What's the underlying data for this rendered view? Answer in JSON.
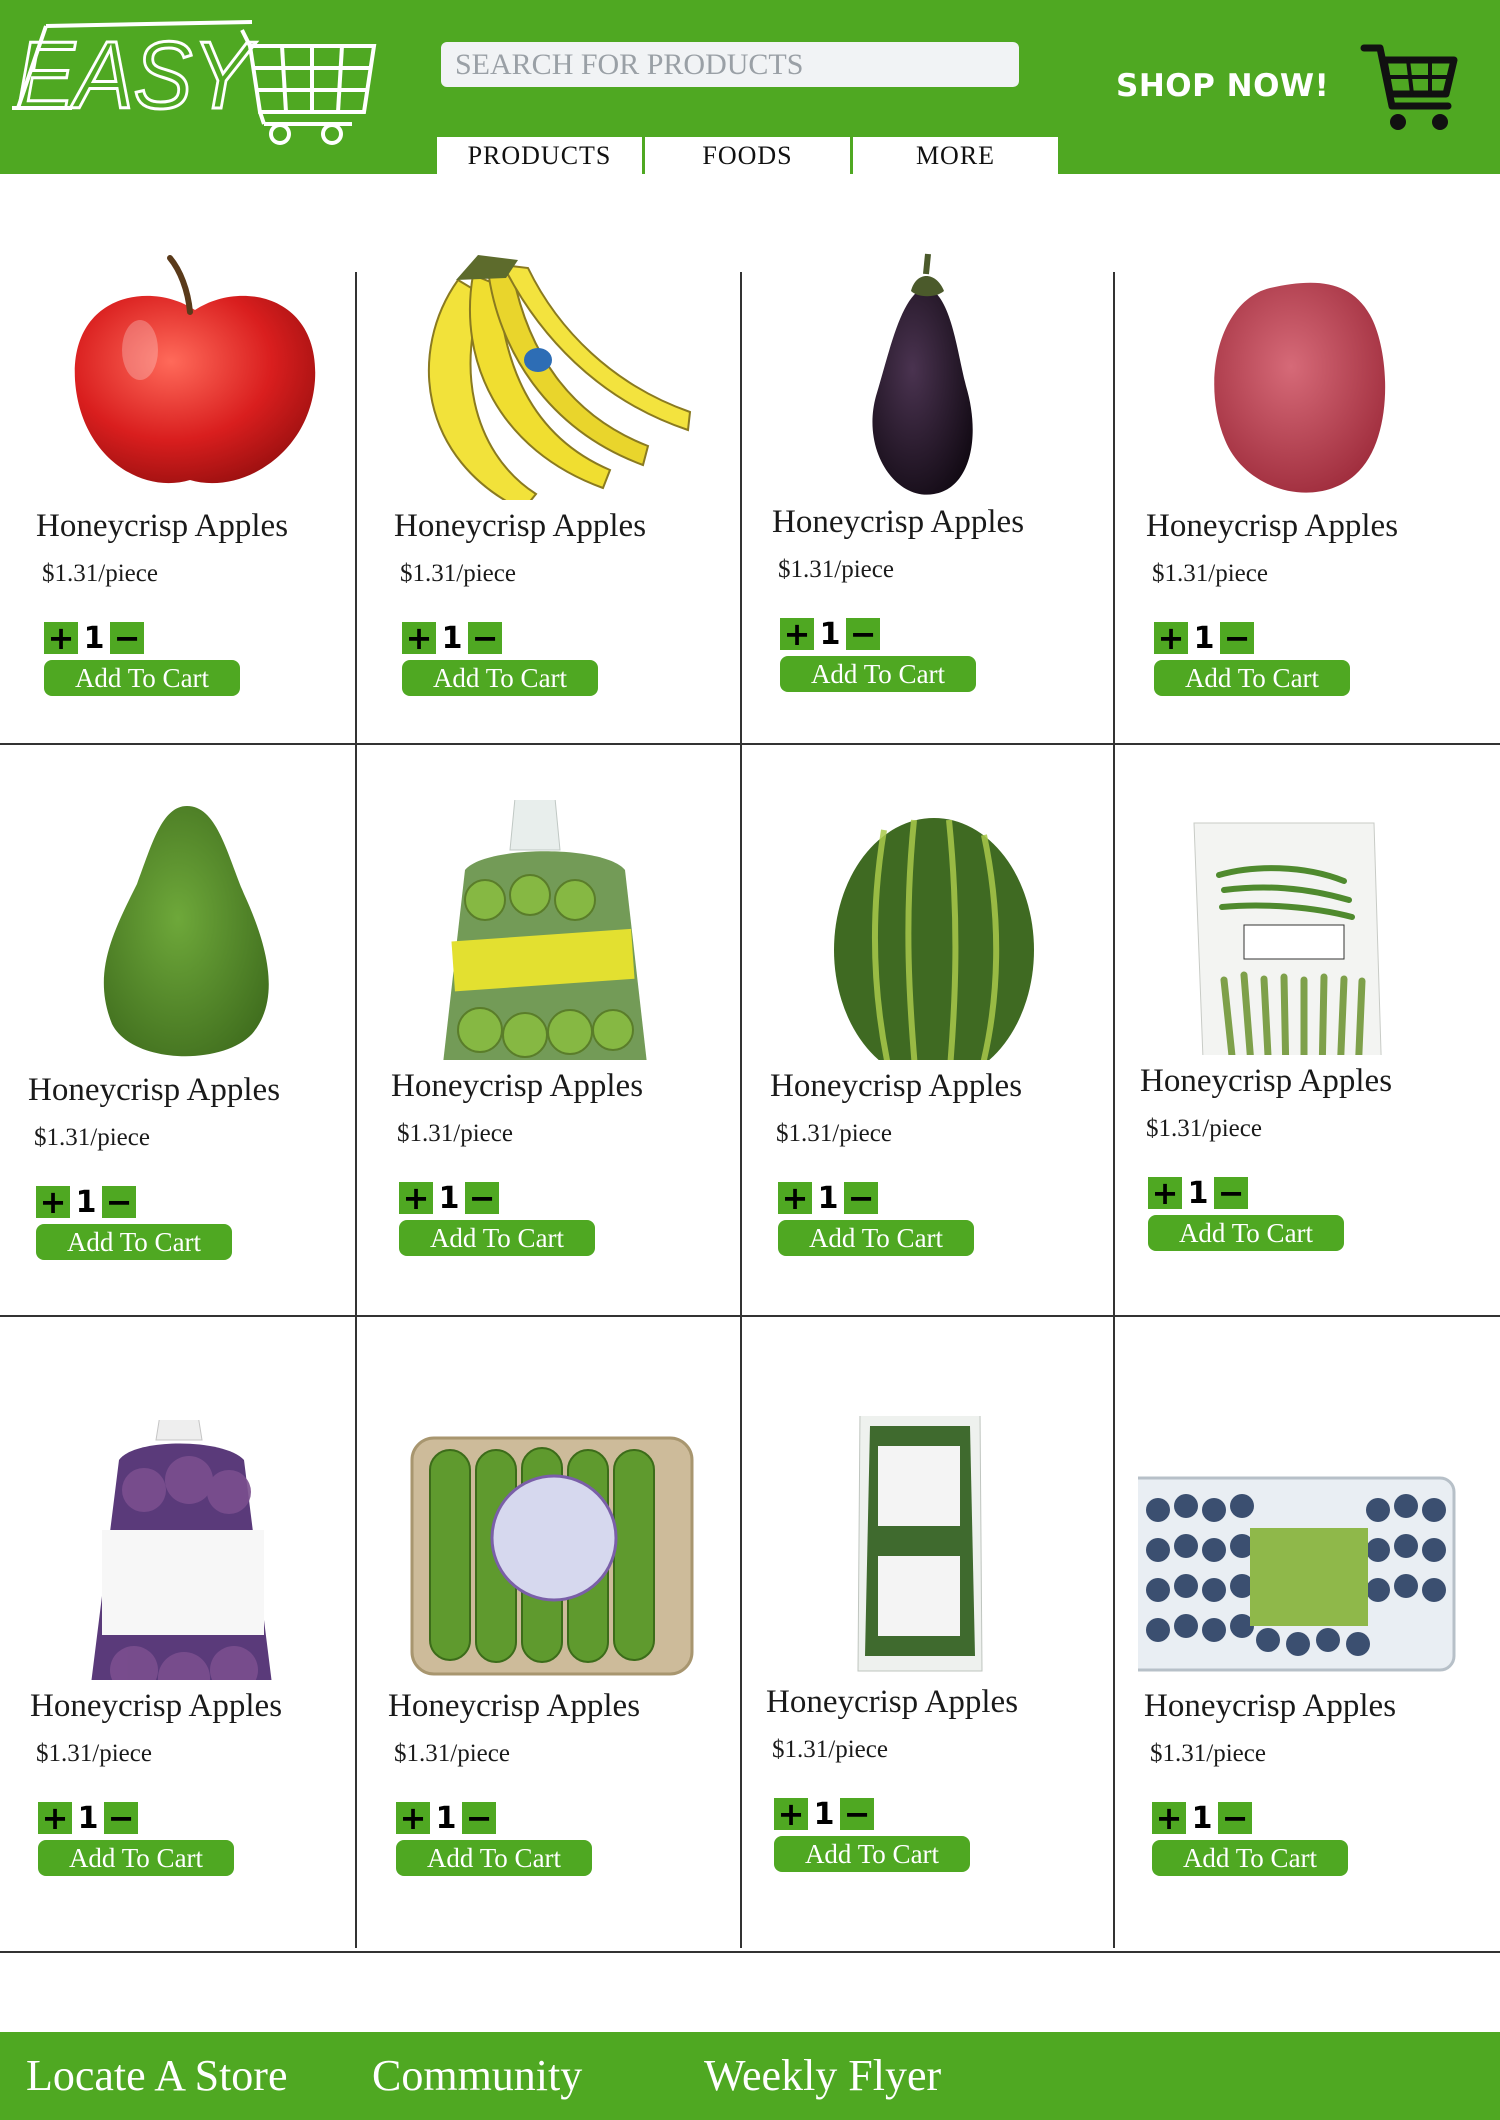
{
  "header": {
    "logo_text": "EASY",
    "search_placeholder": "SEARCH FOR PRODUCTS",
    "shop_now_label": "SHOP NOW!",
    "cart_icon": "shopping-cart-icon",
    "tabs": [
      {
        "label": "PRODUCTS"
      },
      {
        "label": "FOODS"
      },
      {
        "label": "MORE"
      }
    ]
  },
  "colors": {
    "brand_green": "#4fa822",
    "white": "#ffffff",
    "grid_line": "#333333"
  },
  "products": [
    {
      "name": "Honeycrisp Apples",
      "price": "$1.31/piece",
      "qty": "1",
      "add_label": "Add To Cart",
      "image": "red-apple"
    },
    {
      "name": "Honeycrisp Apples",
      "price": "$1.31/piece",
      "qty": "1",
      "add_label": "Add To Cart",
      "image": "bananas"
    },
    {
      "name": "Honeycrisp Apples",
      "price": "$1.31/piece",
      "qty": "1",
      "add_label": "Add To Cart",
      "image": "eggplant"
    },
    {
      "name": "Honeycrisp Apples",
      "price": "$1.31/piece",
      "qty": "1",
      "add_label": "Add To Cart",
      "image": "red-potato"
    },
    {
      "name": "Honeycrisp Apples",
      "price": "$1.31/piece",
      "qty": "1",
      "add_label": "Add To Cart",
      "image": "avocado"
    },
    {
      "name": "Honeycrisp Apples",
      "price": "$1.31/piece",
      "qty": "1",
      "add_label": "Add To Cart",
      "image": "bagged-limes"
    },
    {
      "name": "Honeycrisp Apples",
      "price": "$1.31/piece",
      "qty": "1",
      "add_label": "Add To Cart",
      "image": "watermelon"
    },
    {
      "name": "Honeycrisp Apples",
      "price": "$1.31/piece",
      "qty": "1",
      "add_label": "Add To Cart",
      "image": "green-beans-bag"
    },
    {
      "name": "Honeycrisp Apples",
      "price": "$1.31/piece",
      "qty": "1",
      "add_label": "Add To Cart",
      "image": "red-onions-bag"
    },
    {
      "name": "Honeycrisp Apples",
      "price": "$1.31/piece",
      "qty": "1",
      "add_label": "Add To Cart",
      "image": "mini-cucumbers-tray"
    },
    {
      "name": "Honeycrisp Apples",
      "price": "$1.31/piece",
      "qty": "1",
      "add_label": "Add To Cart",
      "image": "basil-pack"
    },
    {
      "name": "Honeycrisp Apples",
      "price": "$1.31/piece",
      "qty": "1",
      "add_label": "Add To Cart",
      "image": "blueberries-clamshell"
    }
  ],
  "footer": {
    "links": [
      {
        "label": "Locate A Store"
      },
      {
        "label": "Community"
      },
      {
        "label": "Weekly Flyer"
      }
    ]
  }
}
